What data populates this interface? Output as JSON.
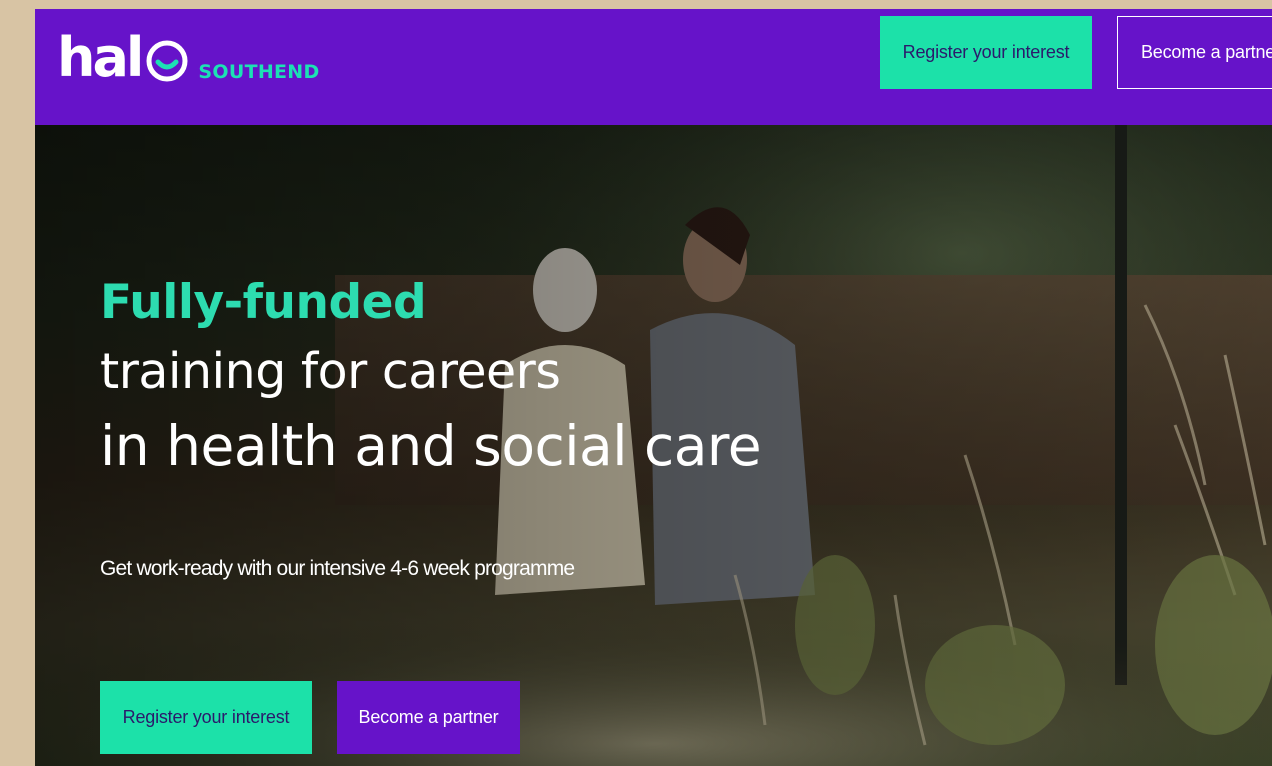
{
  "brand": {
    "logo_word": "hal",
    "logo_sub": "SOUTHEND",
    "purple": "#6613c9",
    "teal": "#1ce1a9"
  },
  "nav": {
    "register_label": "Register your interest",
    "partner_label": "Become a partner"
  },
  "hero": {
    "headline_accent": "Fully-funded",
    "headline_line2": "training for careers",
    "headline_line3": "in health and social care",
    "subtitle": "Get work-ready with our intensive 4-6 week programme",
    "register_label": "Register your interest",
    "partner_label": "Become a partner",
    "background_image": "photo of carer walking with elderly woman through garden"
  }
}
